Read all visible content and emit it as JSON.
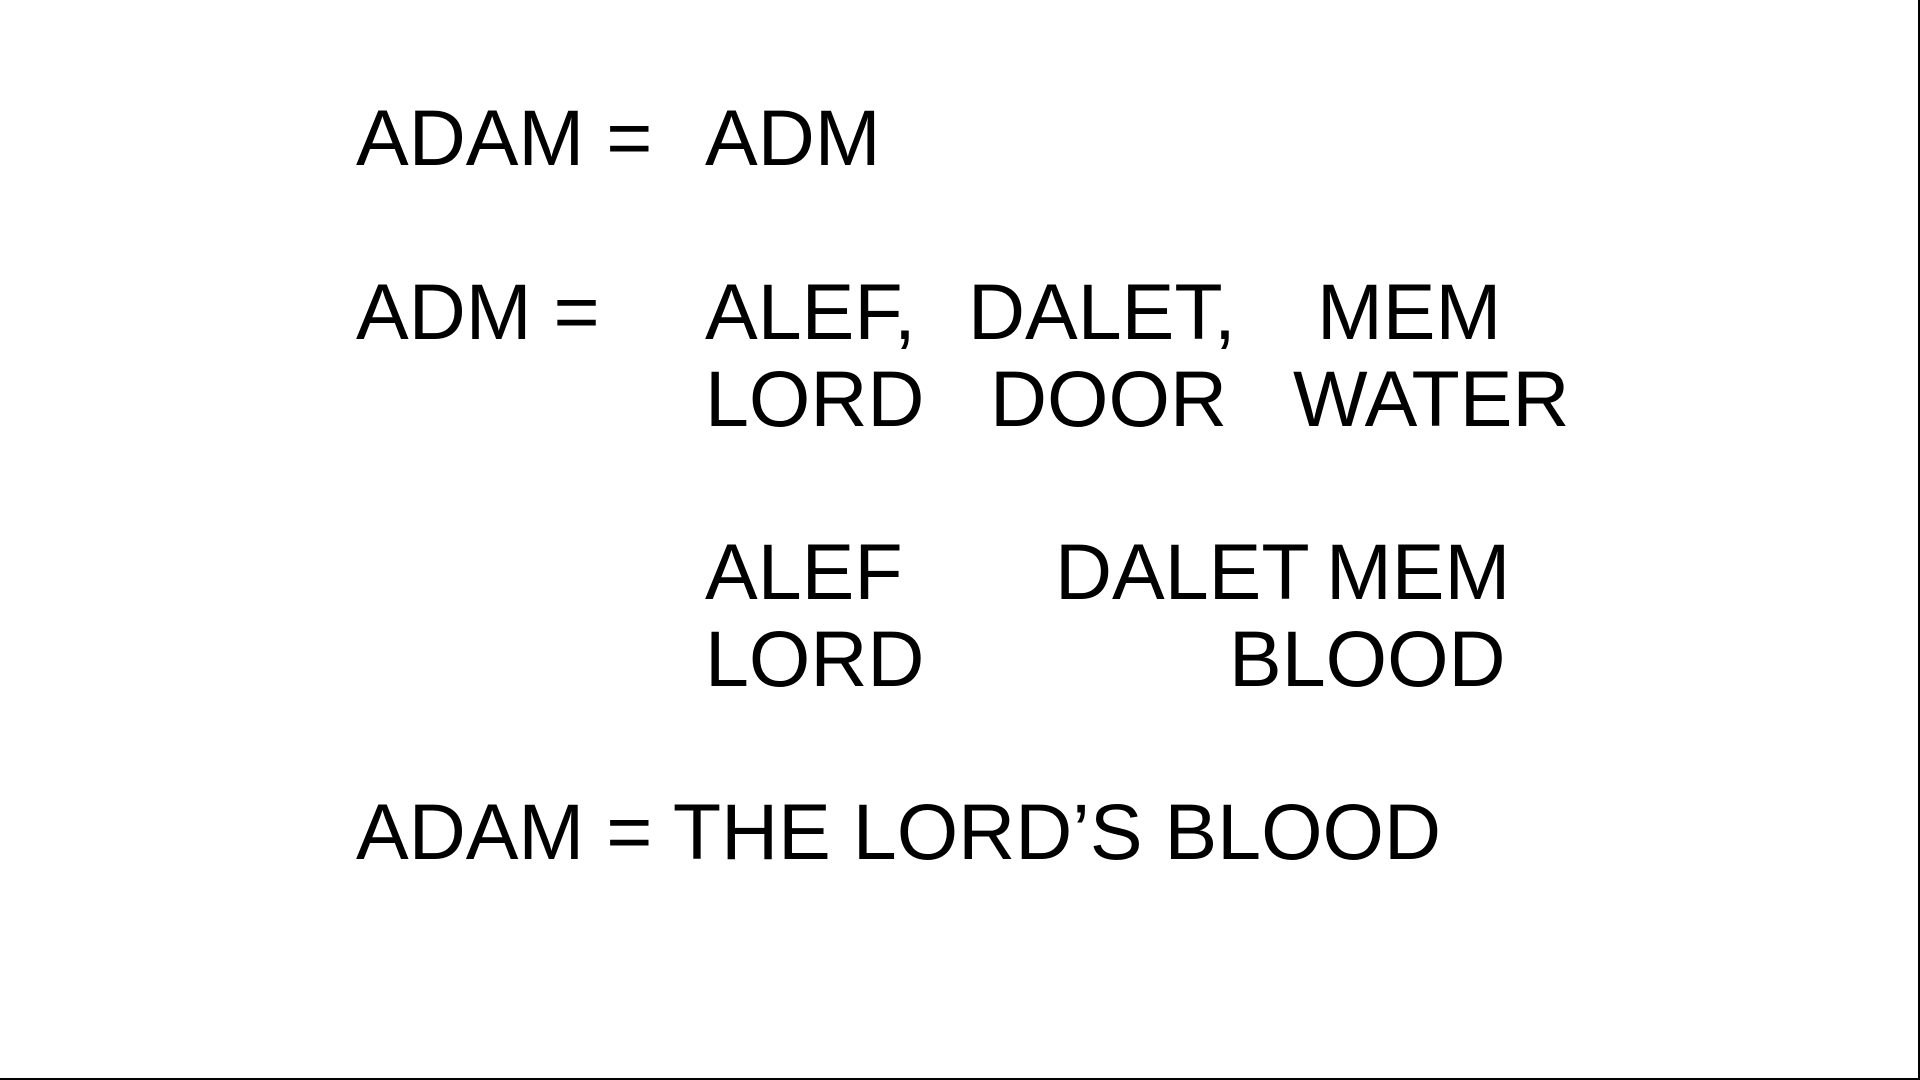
{
  "slide": {
    "line1": {
      "label": "ADAM =",
      "value": "ADM"
    },
    "line2": {
      "label": "ADM =",
      "letters": [
        "ALEF,",
        "DALET,",
        "MEM"
      ]
    },
    "line3": {
      "meanings": [
        "LORD",
        "DOOR",
        "WATER"
      ]
    },
    "line4": {
      "letters": [
        "ALEF",
        "DALET",
        "MEM"
      ]
    },
    "line5": {
      "meanings": [
        "LORD",
        "BLOOD"
      ]
    },
    "conclusion": "ADAM = THE LORD’S BLOOD"
  }
}
